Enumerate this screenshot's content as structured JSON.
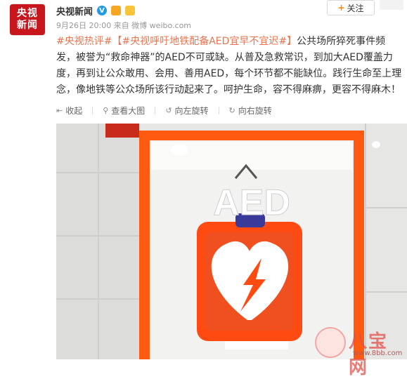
{
  "header": {
    "avatar_line1": "央视",
    "avatar_line2": "新闻",
    "author": "央视新闻",
    "verified_mark": "V",
    "meta": "9月26日 20:00 来自 微博 weibo.com",
    "follow_label": "关注",
    "follow_icon": "+"
  },
  "post": {
    "tag1": "#央视热评#",
    "tag2": "【#央视呼吁地铁配备AED宜早不宜迟#】",
    "body": "公共场所猝死事件频发，被誉为“救命神器”的AED不可或缺。从普及急救常识，到加大AED覆盖力度，再到让公众敢用、会用、善用AED，每个环节都不能缺位。践行生命至上理念，像地铁等公众场所该行动起来了。呵护生命，容不得麻痹，更容不得麻木！"
  },
  "toolbar": {
    "collapse": "收起",
    "view_large": "查看大图",
    "rotate_left": "向左旋转",
    "rotate_right": "向右旋转"
  },
  "photo": {
    "aed_label": "AED"
  },
  "watermark": {
    "text": "八宝网",
    "url": "www.8bb.com"
  }
}
